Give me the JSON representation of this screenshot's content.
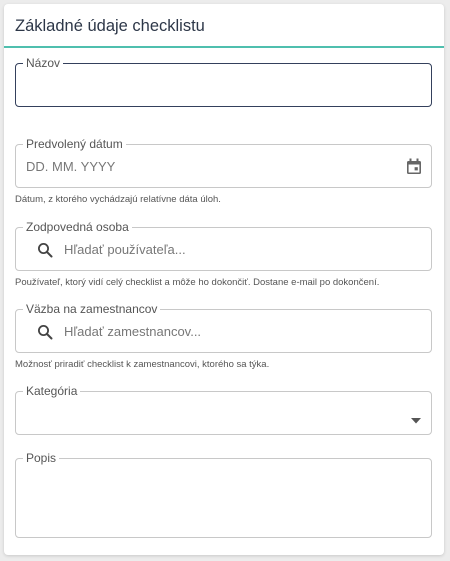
{
  "form": {
    "title": "Základné údaje checklistu",
    "name": {
      "label": "Názov",
      "value": ""
    },
    "date": {
      "label": "Predvolený dátum",
      "placeholder": "DD. MM. YYYY",
      "helper": "Dátum, z ktorého vychádzajú relatívne dáta úloh.",
      "icon": "calendar-icon"
    },
    "responsible": {
      "label": "Zodpovedná osoba",
      "placeholder": "Hľadať používateľa...",
      "helper": "Používateľ, ktorý vidí celý checklist a môže ho dokončiť. Dostane e-mail po dokončení.",
      "icon": "search-icon"
    },
    "employee": {
      "label": "Väzba na zamestnancov",
      "placeholder": "Hľadať zamestnancov...",
      "helper": "Možnosť priradiť checklist k zamestnancovi, ktorého sa týka.",
      "icon": "search-icon"
    },
    "category": {
      "label": "Kategória",
      "value": "",
      "icon": "caret-down-icon"
    },
    "description": {
      "label": "Popis",
      "value": ""
    }
  },
  "colors": {
    "accent": "#4fbfae",
    "focus": "#34405c",
    "border": "#c8c8c8"
  }
}
